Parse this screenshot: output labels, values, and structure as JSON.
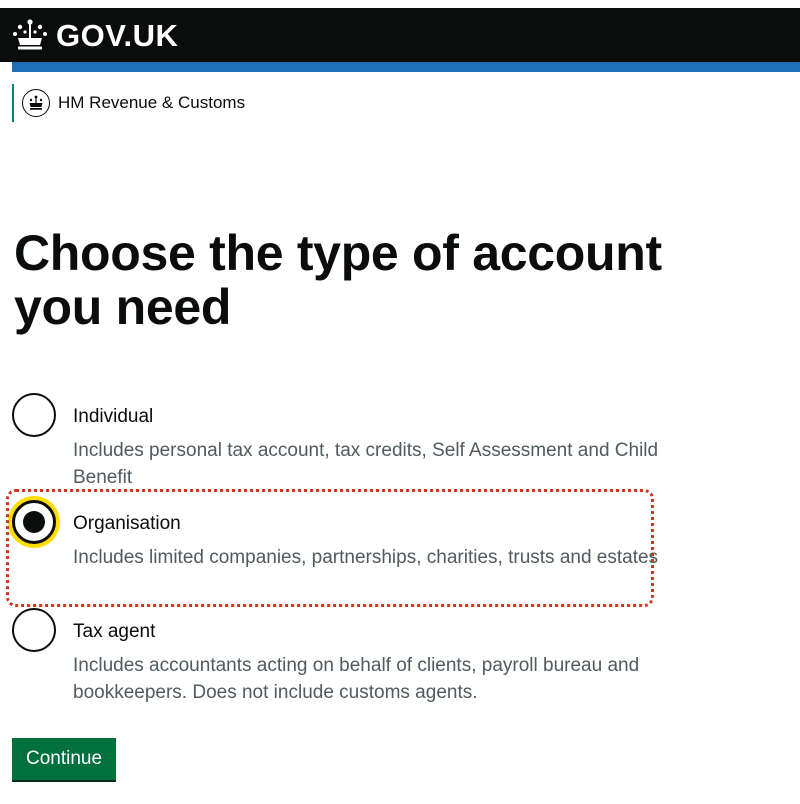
{
  "header": {
    "logo_text": "GOV.UK",
    "crown_icon": "crown-icon"
  },
  "organisation": {
    "name": "HM Revenue & Customs",
    "crest_icon": "hmrc-crest-icon"
  },
  "main": {
    "title": "Choose the type of account you need",
    "options": [
      {
        "label": "Individual",
        "hint": "Includes personal tax account, tax credits, Self Assessment and Child Benefit",
        "selected": false
      },
      {
        "label": "Organisation",
        "hint": "Includes limited companies, partnerships, charities, trusts and estates",
        "selected": true
      },
      {
        "label": "Tax agent",
        "hint": "Includes accountants acting on behalf of clients, payroll bureau and bookkeepers. Does not include customs agents.",
        "selected": false
      }
    ],
    "continue_label": "Continue"
  },
  "colors": {
    "header_bg": "#0b0c0c",
    "brand_blue": "#1d70b8",
    "focus_yellow": "#ffdd00",
    "button_green": "#00703c",
    "annotation_red": "#d4351c",
    "hint_grey": "#505a5f"
  }
}
